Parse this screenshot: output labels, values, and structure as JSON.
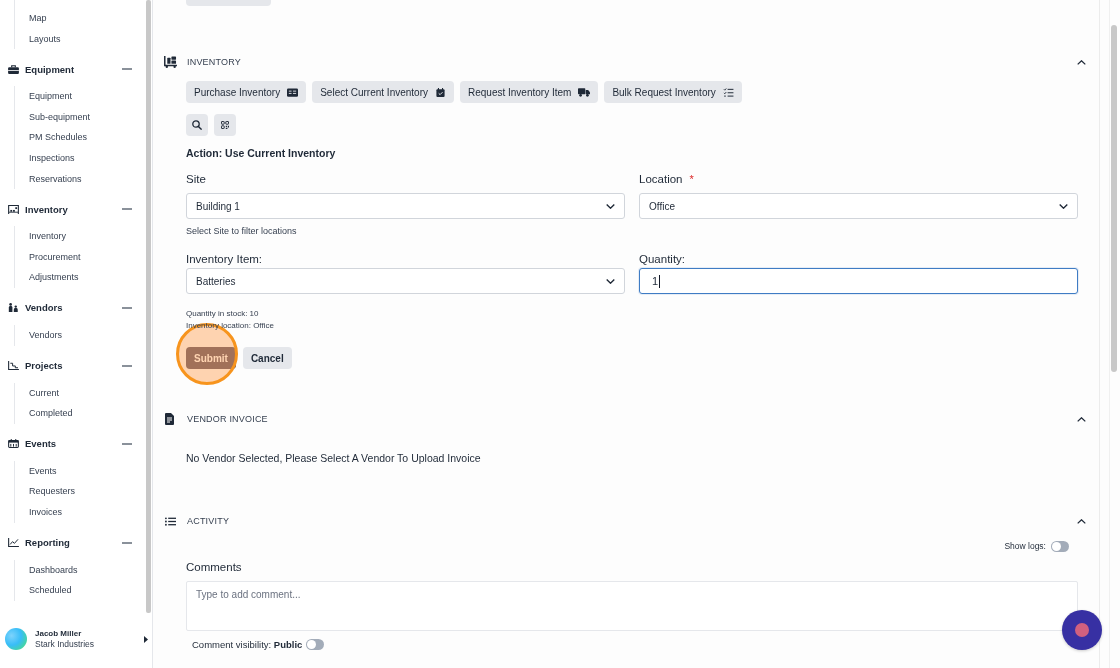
{
  "sidebar": {
    "top_items": [
      "Map",
      "Layouts"
    ],
    "groups": [
      {
        "title": "Equipment",
        "expanded": true,
        "items": [
          "Equipment",
          "Sub-equipment",
          "PM Schedules",
          "Inspections",
          "Reservations"
        ]
      },
      {
        "title": "Inventory",
        "expanded": true,
        "items": [
          "Inventory",
          "Procurement",
          "Adjustments"
        ]
      },
      {
        "title": "Vendors",
        "expanded": true,
        "items": [
          "Vendors"
        ]
      },
      {
        "title": "Projects",
        "expanded": true,
        "items": [
          "Current",
          "Completed"
        ]
      },
      {
        "title": "Events",
        "expanded": true,
        "items": [
          "Events",
          "Requesters",
          "Invoices"
        ]
      },
      {
        "title": "Reporting",
        "expanded": true,
        "items": [
          "Dashboards",
          "Scheduled"
        ]
      }
    ],
    "user": {
      "name": "Jacob Miller",
      "company": "Stark Industries"
    }
  },
  "sections": [
    {
      "kind": "inventory",
      "title": "INVENTORY",
      "expanded": true,
      "action_buttons": [
        "Purchase Inventory",
        "Select Current Inventory",
        "Request Inventory Item",
        "Bulk Request Inventory"
      ],
      "action_title": "Action: Use Current Inventory",
      "fields": [
        {
          "kind": "select",
          "label": "Site",
          "value": "Building 1",
          "hint": "Select Site to filter locations"
        },
        {
          "kind": "select",
          "label": "Location",
          "required_mark": "*",
          "value": "Office"
        },
        {
          "kind": "select",
          "label": "Inventory Item:",
          "value": "Batteries"
        },
        {
          "kind": "input",
          "label": "Quantity:",
          "value": "1",
          "focused": true
        }
      ],
      "stock_info": [
        "Quantity in stock: 10",
        "Inventory location: Office"
      ],
      "buttons": [
        {
          "kind": "primary",
          "label": "Submit",
          "highlighted": true
        },
        {
          "kind": "secondary",
          "label": "Cancel",
          "highlighted": false
        }
      ]
    },
    {
      "kind": "vendor_invoice",
      "title": "VENDOR INVOICE",
      "expanded": true,
      "message": "No Vendor Selected, Please Select A Vendor To Upload Invoice"
    },
    {
      "kind": "activity",
      "title": "ACTIVITY",
      "expanded": true,
      "show_logs": {
        "label": "Show logs:",
        "on": false
      },
      "comments_label": "Comments",
      "comment_placeholder": "Type to add comment...",
      "visibility": {
        "label": "Comment visibility: **Public**",
        "on": false
      }
    }
  ]
}
